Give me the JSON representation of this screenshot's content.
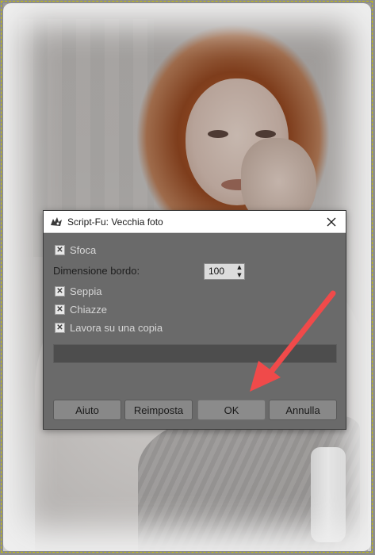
{
  "dialog": {
    "title": "Script-Fu: Vecchia foto",
    "options": {
      "blur": {
        "label": "Sfoca",
        "checked": true
      },
      "border_size": {
        "label": "Dimensione bordo:",
        "value": "100"
      },
      "sepia": {
        "label": "Seppia",
        "checked": true
      },
      "mottle": {
        "label": "Chiazze",
        "checked": true
      },
      "work_on_copy": {
        "label": "Lavora su una copia",
        "checked": true
      }
    },
    "progress_fraction": 0,
    "buttons": {
      "help": "Aiuto",
      "reset": "Reimposta",
      "ok": "OK",
      "cancel": "Annulla"
    }
  },
  "icons": {
    "app": "gimp-wilber-icon",
    "close": "close-icon",
    "check": "checkmark-icon",
    "spin_up": "spin-up-icon",
    "spin_down": "spin-down-icon"
  },
  "colors": {
    "arrow": "#f04a4a",
    "dialog_bg": "#6a6a6a",
    "titlebar_bg": "#ffffff",
    "layer_boundary": "#c8c400"
  }
}
